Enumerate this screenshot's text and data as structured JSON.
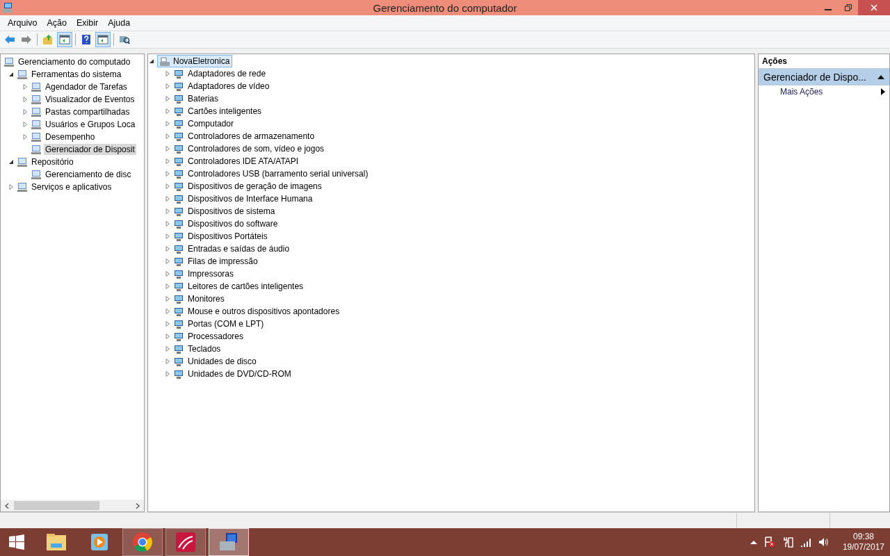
{
  "window": {
    "title": "Gerenciamento do computador"
  },
  "menu": [
    "Arquivo",
    "Ação",
    "Exibir",
    "Ajuda"
  ],
  "toolbar": [
    {
      "kind": "back",
      "selected": false
    },
    {
      "kind": "forward",
      "selected": false
    },
    {
      "kind": "sep"
    },
    {
      "kind": "up",
      "selected": false
    },
    {
      "kind": "pane",
      "selected": true
    },
    {
      "kind": "sep"
    },
    {
      "kind": "help",
      "selected": false
    },
    {
      "kind": "pane2",
      "selected": true
    },
    {
      "kind": "sep"
    },
    {
      "kind": "scan",
      "selected": false
    }
  ],
  "tree": [
    {
      "label": "Gerenciamento do computado",
      "selected": false,
      "children": [
        {
          "label": "Ferramentas do sistema",
          "expanded": true,
          "selected": false,
          "children": [
            {
              "label": "Agendador de Tarefas",
              "expanded": false,
              "selected": false
            },
            {
              "label": "Visualizador de Eventos",
              "expanded": false,
              "selected": false
            },
            {
              "label": "Pastas compartilhadas",
              "expanded": false,
              "selected": false
            },
            {
              "label": "Usuários e Grupos Loca",
              "expanded": false,
              "selected": false
            },
            {
              "label": "Desempenho",
              "expanded": false,
              "selected": false
            },
            {
              "label": "Gerenciador de Disposit",
              "selected": true
            }
          ]
        },
        {
          "label": "Repositório",
          "expanded": true,
          "selected": false,
          "children": [
            {
              "label": "Gerenciamento de disc",
              "selected": false
            }
          ]
        },
        {
          "label": "Serviços e aplicativos",
          "expanded": false,
          "selected": false
        }
      ]
    }
  ],
  "devices": {
    "computer": "NovaEletronica",
    "expanded": true,
    "selected": true,
    "categories": [
      {
        "label": "Adaptadores de rede",
        "expanded": false
      },
      {
        "label": "Adaptadores de vídeo",
        "expanded": false
      },
      {
        "label": "Baterias",
        "expanded": false
      },
      {
        "label": "Cartões inteligentes",
        "expanded": false
      },
      {
        "label": "Computador",
        "expanded": false
      },
      {
        "label": "Controladores de armazenamento",
        "expanded": false
      },
      {
        "label": "Controladores de som, vídeo e jogos",
        "expanded": false
      },
      {
        "label": "Controladores IDE ATA/ATAPI",
        "expanded": false
      },
      {
        "label": "Controladores USB (barramento serial universal)",
        "expanded": false
      },
      {
        "label": "Dispositivos de geração de imagens",
        "expanded": false
      },
      {
        "label": "Dispositivos de Interface Humana",
        "expanded": false
      },
      {
        "label": "Dispositivos de sistema",
        "expanded": false
      },
      {
        "label": "Dispositivos do software",
        "expanded": false
      },
      {
        "label": "Dispositivos Portáteis",
        "expanded": false
      },
      {
        "label": "Entradas e saídas de áudio",
        "expanded": false
      },
      {
        "label": "Filas de impressão",
        "expanded": false
      },
      {
        "label": "Impressoras",
        "expanded": false
      },
      {
        "label": "Leitores de cartões inteligentes",
        "expanded": false
      },
      {
        "label": "Monitores",
        "expanded": false
      },
      {
        "label": "Mouse e outros dispositivos apontadores",
        "expanded": false
      },
      {
        "label": "Portas (COM e LPT)",
        "expanded": false
      },
      {
        "label": "Processadores",
        "expanded": false
      },
      {
        "label": "Teclados",
        "expanded": false
      },
      {
        "label": "Unidades de disco",
        "expanded": false
      },
      {
        "label": "Unidades de DVD/CD-ROM",
        "expanded": false
      }
    ]
  },
  "actions": {
    "title": "Ações",
    "section": "Gerenciador de Dispo...",
    "expanded": true,
    "items": [
      "Mais Ações"
    ]
  },
  "taskbar": {
    "apps": [
      {
        "kind": "explorer",
        "running": false,
        "selected": false
      },
      {
        "kind": "media",
        "running": false,
        "selected": false
      },
      {
        "kind": "chrome",
        "running": true,
        "selected": false
      },
      {
        "kind": "red",
        "running": true,
        "selected": false
      },
      {
        "kind": "devmgr",
        "running": true,
        "selected": true
      }
    ],
    "time": "09:38",
    "date": "19/07/2017"
  }
}
